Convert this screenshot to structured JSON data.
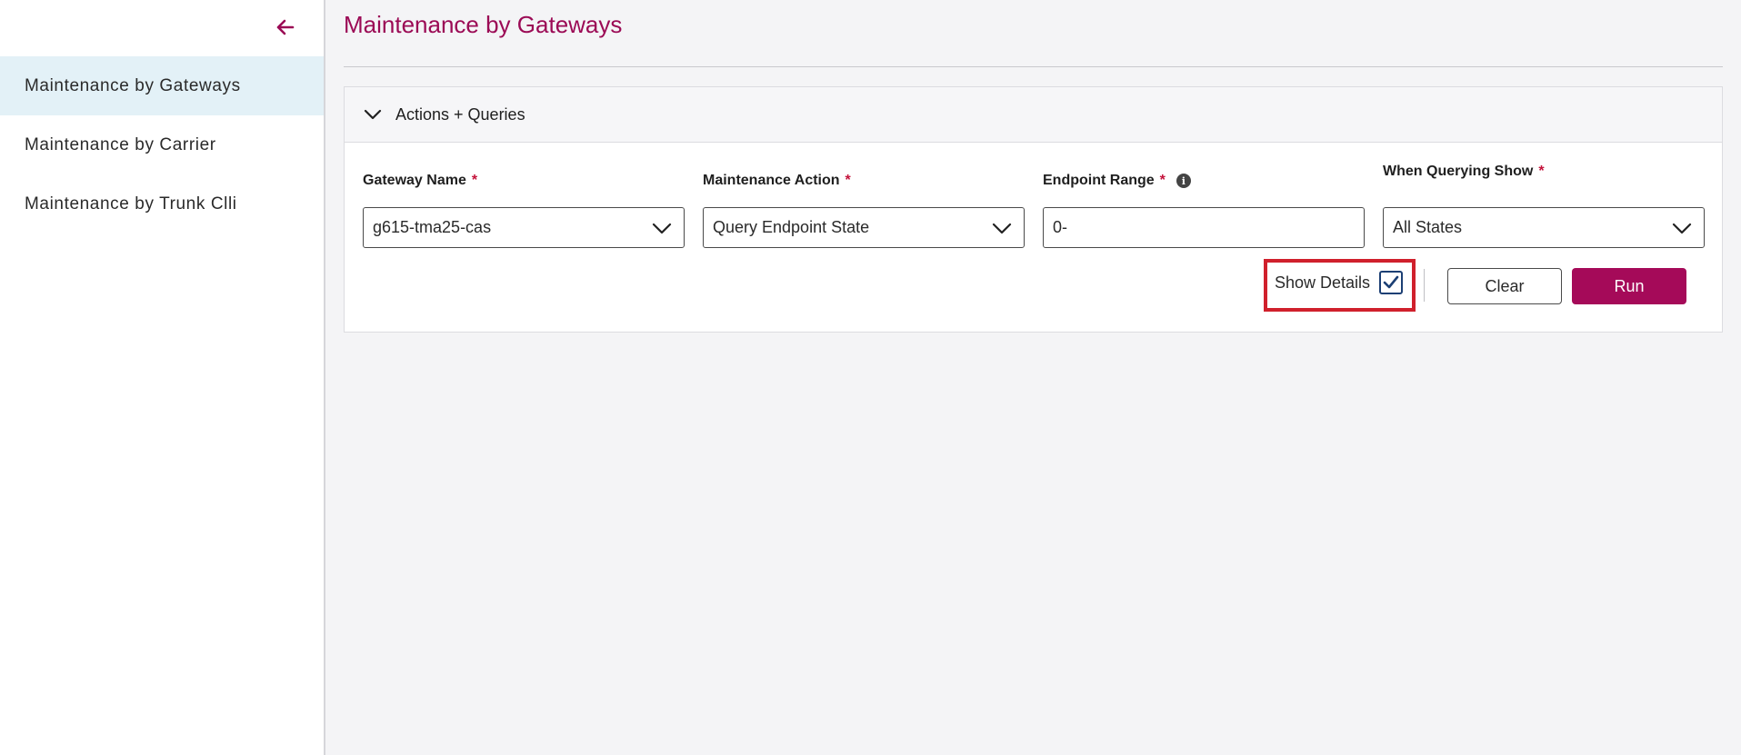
{
  "sidebar": {
    "collapse_icon": "arrow-left-icon",
    "items": [
      {
        "label": "Maintenance by Gateways",
        "active": true
      },
      {
        "label": "Maintenance by Carrier",
        "active": false
      },
      {
        "label": "Maintenance by Trunk Clli",
        "active": false
      }
    ]
  },
  "main": {
    "title": "Maintenance by Gateways",
    "panel": {
      "header_label": "Actions + Queries",
      "header_icon": "chevron-down-icon",
      "fields": {
        "gateway_name": {
          "label": "Gateway Name",
          "required_mark": "*",
          "value": "g615-tma25-cas"
        },
        "maintenance_action": {
          "label": "Maintenance Action",
          "required_mark": "*",
          "value": "Query Endpoint State"
        },
        "endpoint_range": {
          "label": "Endpoint Range",
          "required_mark": "*",
          "value": "0-",
          "info_icon": "info-icon"
        },
        "when_querying_show": {
          "label": "When Querying Show",
          "required_mark": "*",
          "value": "All States"
        }
      },
      "show_details": {
        "label": "Show Details",
        "checked": true
      },
      "clear_label": "Clear",
      "run_label": "Run"
    }
  },
  "colors": {
    "brand": "#a50a59",
    "title": "#9b0a55",
    "active_nav_bg": "#e3f1f7",
    "required": "#c4123a",
    "highlight": "#d0202c",
    "checkbox": "#1c3f74"
  }
}
